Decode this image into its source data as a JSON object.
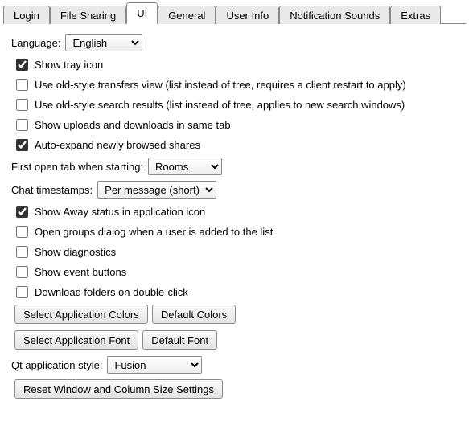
{
  "tabs": [
    {
      "label": "Login"
    },
    {
      "label": "File Sharing"
    },
    {
      "label": "UI"
    },
    {
      "label": "General"
    },
    {
      "label": "User Info"
    },
    {
      "label": "Notification Sounds"
    },
    {
      "label": "Extras"
    }
  ],
  "language_label": "Language:",
  "language_value": "English",
  "firstopen_label": "First open tab when starting:",
  "firstopen_value": "Rooms",
  "chattime_label": "Chat timestamps:",
  "chattime_value": "Per message (short)",
  "qtstyle_label": "Qt application style:",
  "qtstyle_value": "Fusion",
  "checks": {
    "tray": "Show tray icon",
    "old_transfers": "Use old-style transfers view (list instead of tree, requires a client restart to apply)",
    "old_search": "Use old-style search results (list instead of tree, applies to new search windows)",
    "same_tab": "Show uploads and downloads in same tab",
    "auto_expand": "Auto-expand newly browsed shares",
    "away": "Show Away status in application icon",
    "open_groups": "Open groups dialog when a user is added to the list",
    "diag": "Show diagnostics",
    "events": "Show event buttons",
    "dbl": "Download folders on double-click"
  },
  "buttons": {
    "sel_colors": "Select Application Colors",
    "def_colors": "Default Colors",
    "sel_font": "Select Application Font",
    "def_font": "Default Font",
    "reset": "Reset Window and Column Size Settings"
  }
}
